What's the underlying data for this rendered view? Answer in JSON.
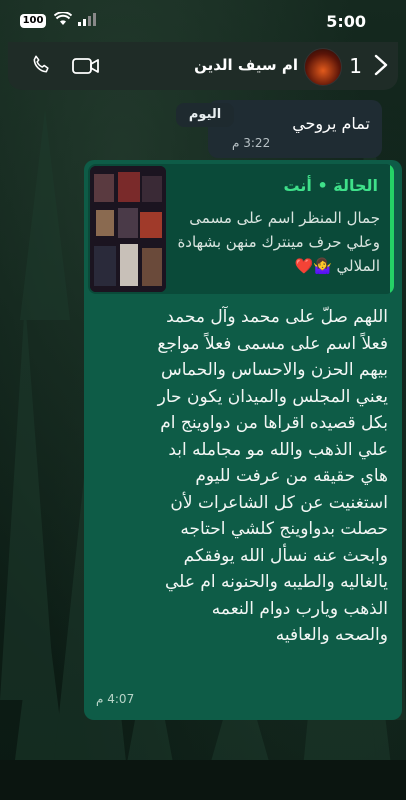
{
  "status_bar": {
    "time": "5:00",
    "battery": "100"
  },
  "header": {
    "back_count": "1",
    "contact_name": "ام سيف الدين"
  },
  "incoming": {
    "text": "تمام يروحي",
    "time": "3:22 م"
  },
  "date_chip": "اليوم",
  "outgoing": {
    "quote_title": "الحالة • أنت",
    "quote_body": "جمال المنظر اسم على مسمى وعلي حرف مينترك منهن بشهادة الملالي 🤷‍♀️❤️",
    "message_lines": [
      "اللهم صلّ على محمد وآل محمد",
      "فعلاً اسم على مسمى فعلاً مواجع",
      "بيهم الحزن والاحساس والحماس",
      "يعني المجلس والميدان يكون حار",
      "بكل قصيده اقراها من دواوينج ام",
      "علي الذهب والله مو مجامله ابد",
      "هاي حقيقه من عرفت لليوم",
      "استغنيت عن كل الشاعرات لأن",
      "حصلت بدواوينج كلشي احتاجه",
      "وابحث عنه نسأل الله يوفقكم",
      "يالغاليه والطيبه والحنونه ام علي",
      "الذهب ويارب دوام النعمه",
      "والصحه والعافيه"
    ],
    "time": "4:07 م"
  },
  "colors": {
    "outgoing_bubble": "#0e5c47",
    "quote_accent": "#3fe08a",
    "header_bg": "#1f2c27"
  }
}
